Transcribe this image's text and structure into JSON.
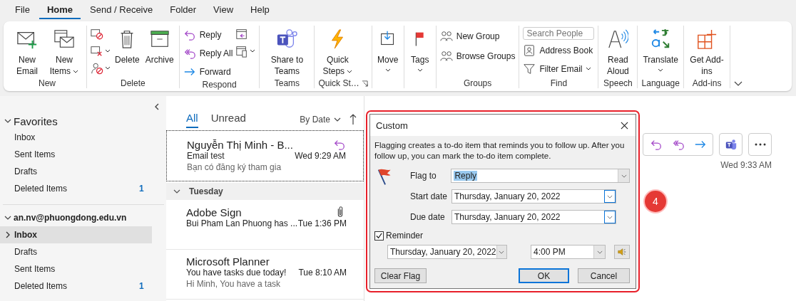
{
  "menu_tabs": [
    {
      "label": "File",
      "selected": false
    },
    {
      "label": "Home",
      "selected": true
    },
    {
      "label": "Send / Receive",
      "selected": false
    },
    {
      "label": "Folder",
      "selected": false
    },
    {
      "label": "View",
      "selected": false
    },
    {
      "label": "Help",
      "selected": false
    }
  ],
  "ribbon": {
    "groups": [
      {
        "label": "New",
        "buttons": [
          {
            "label": "New Email"
          },
          {
            "label": "New Items"
          }
        ]
      },
      {
        "label": "Delete",
        "buttons": [
          {
            "label": "Delete"
          },
          {
            "label": "Archive"
          }
        ]
      },
      {
        "label": "Respond",
        "buttons": [
          {
            "label": "Reply"
          },
          {
            "label": "Reply All"
          },
          {
            "label": "Forward"
          }
        ]
      },
      {
        "label": "Teams",
        "buttons": [
          {
            "label": "Share to Teams"
          }
        ]
      },
      {
        "label": "Quick St…",
        "buttons": [
          {
            "label": "Quick Steps"
          }
        ]
      },
      {
        "buttons": [
          {
            "label": "Move"
          }
        ]
      },
      {
        "buttons": [
          {
            "label": "Tags"
          }
        ]
      },
      {
        "label": "Groups",
        "buttons": [
          {
            "label": "New Group"
          },
          {
            "label": "Browse Groups"
          }
        ]
      },
      {
        "label": "Find",
        "search": {
          "placeholder": "Search People"
        },
        "buttons": [
          {
            "label": "Address Book"
          },
          {
            "label": "Filter Email"
          }
        ]
      },
      {
        "label": "Speech",
        "buttons": [
          {
            "label": "Read Aloud"
          }
        ]
      },
      {
        "label": "Language",
        "buttons": [
          {
            "label": "Translate"
          }
        ]
      },
      {
        "label": "Add-ins",
        "buttons": [
          {
            "label": "Get Add-ins"
          }
        ]
      }
    ]
  },
  "sidebar": {
    "favorites": {
      "label": "Favorites",
      "expanded": true,
      "items": [
        {
          "label": "Inbox",
          "selected": false
        },
        {
          "label": "Sent Items",
          "selected": false
        },
        {
          "label": "Drafts",
          "selected": false
        },
        {
          "label": "Deleted Items",
          "count": "1",
          "selected": false
        }
      ]
    },
    "account": {
      "label": "an.nv@phuongdong.edu.vn",
      "expanded": true,
      "items": [
        {
          "label": "Inbox",
          "expandable": true,
          "selected": true
        },
        {
          "label": "Drafts",
          "expandable": false,
          "selected": false
        },
        {
          "label": "Sent Items",
          "expandable": false,
          "selected": false
        },
        {
          "label": "Deleted Items",
          "count": "1",
          "expandable": false,
          "selected": false
        }
      ]
    }
  },
  "mail_list": {
    "tabs": [
      {
        "label": "All",
        "selected": true
      },
      {
        "label": "Unread",
        "selected": false
      }
    ],
    "sort": "By Date",
    "items": [
      {
        "kind": "message",
        "sender": "Nguyễn Thị Minh - B...",
        "subject": "Email test",
        "preview": "Bạn có đăng ký tham gia",
        "time": "Wed 9:29 AM",
        "replied": true,
        "attachment": false,
        "selected": true
      },
      {
        "kind": "group",
        "label": "Tuesday",
        "expanded": true
      },
      {
        "kind": "message",
        "sender": "Adobe Sign",
        "subject": "Bui Pham Lan Phuong has ...",
        "time": "Tue 1:36 PM",
        "replied": false,
        "attachment": true,
        "selected": false
      },
      {
        "kind": "message",
        "sender": "Microsoft Planner",
        "subject": "You have tasks due today!",
        "preview": "Hi Minh,  You have a task",
        "time": "Tue 8:10 AM",
        "replied": false,
        "attachment": false,
        "selected": false
      }
    ]
  },
  "reading_pane": {
    "time": "Wed 9:33 AM"
  },
  "step_badge": "4",
  "dialog": {
    "title": "Custom",
    "description": "Flagging creates a to-do item that reminds you to follow up. After you follow up, you can mark the to-do item complete.",
    "flag_to": {
      "label": "Flag to",
      "value": "Reply"
    },
    "start_date": {
      "label": "Start date",
      "value": "Thursday, January 20, 2022"
    },
    "due_date": {
      "label": "Due date",
      "value": "Thursday, January 20, 2022"
    },
    "reminder": {
      "label": "Reminder",
      "checked": true,
      "date": "Thursday, January 20, 2022",
      "time": "4:00 PM"
    },
    "buttons": [
      {
        "label": "Clear Flag",
        "default": false
      },
      {
        "label": "OK",
        "default": true
      },
      {
        "label": "Cancel",
        "default": false
      }
    ]
  }
}
